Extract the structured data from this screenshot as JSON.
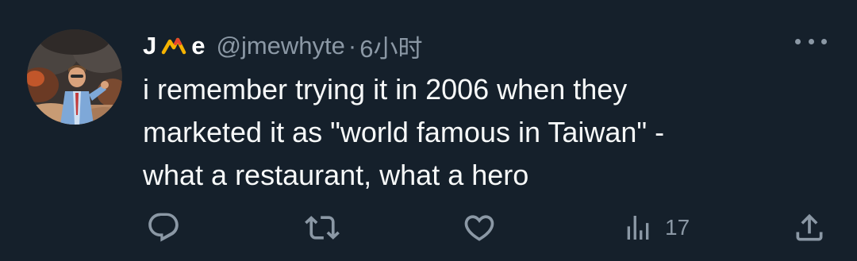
{
  "tweet": {
    "display_name_start": "J",
    "display_name_end": "e",
    "display_name_emoji": "mountain-emoji",
    "handle": "@jmewhyte",
    "separator": "·",
    "time": "6小时",
    "text": "i remember trying it in 2006 when they\nmarketed it as \"world famous in Taiwan\" -\nwhat a restaurant, what a hero"
  },
  "actions": {
    "reply_icon": "reply-icon",
    "retweet_icon": "retweet-icon",
    "like_icon": "heart-icon",
    "views_icon": "views-icon",
    "views_count": "17",
    "share_icon": "share-icon"
  },
  "colors": {
    "background": "#15202b",
    "text": "#f7f9f9",
    "muted": "#8b98a5",
    "emoji_yellow": "#f5b301"
  }
}
